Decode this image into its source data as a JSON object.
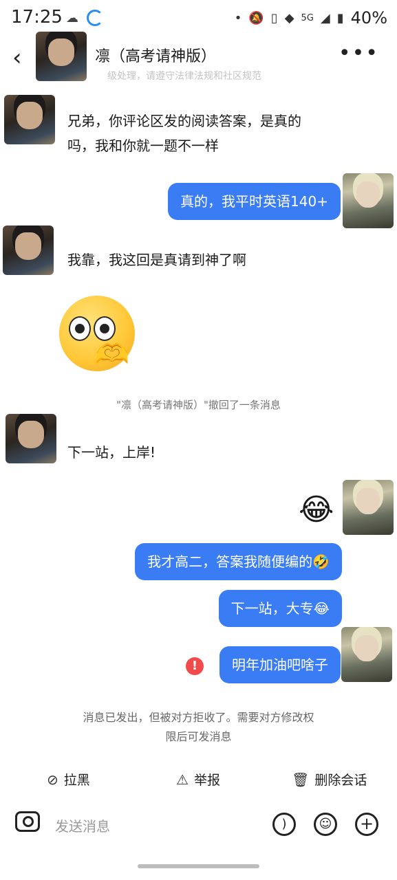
{
  "status_bar": {
    "time": "17:25",
    "network": "5G",
    "battery": "40%"
  },
  "header": {
    "title": "凛（高考请神版）",
    "notice_faded": "级处理，请遵守法律法规和社区规范"
  },
  "messages": {
    "m1_line1": "兄弟，你评论区发的阅读答案，是真的",
    "m1_line2": "吗，我和你就一题不一样",
    "m2": "真的，我平时英语140+",
    "m3": "我靠，我这回是真请到神了啊",
    "m4_sticker": "🫶",
    "recall_notice": "\"凛（高考请神版）\"撤回了一条消息",
    "m5": "下一站，上岸!",
    "m6_emoji": "😂",
    "m7": "我才高二，答案我随便编的🤣",
    "m8": "下一站，大专😂",
    "m9": "明年加油吧啥子",
    "error_mark": "!",
    "reject_line1": "消息已发出，但被对方拒收了。需要对方修改权",
    "reject_line2": "限后可发消息"
  },
  "actions": {
    "block": "拉黑",
    "report": "举报",
    "delete": "删除会话"
  },
  "input": {
    "placeholder": "发送消息"
  },
  "colors": {
    "bubble_blue": "#3a7cf4",
    "error_red": "#f04a4a"
  }
}
